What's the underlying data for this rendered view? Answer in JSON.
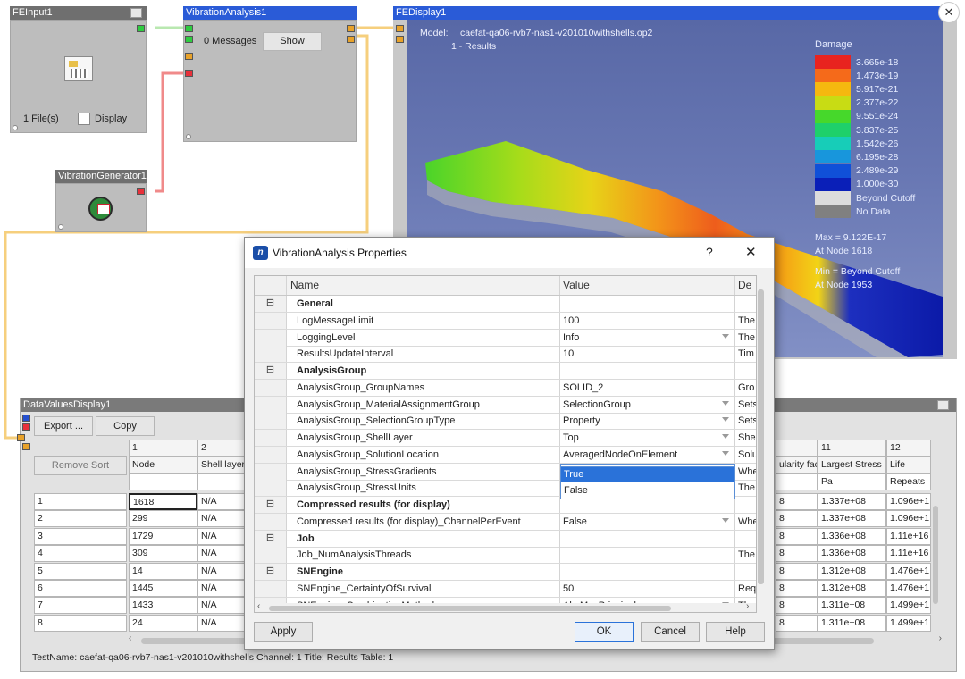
{
  "nodes": {
    "feinput": {
      "title": "FEInput1",
      "files_label": "1 File(s)",
      "display_label": "Display"
    },
    "vibration_analysis": {
      "title": "VibrationAnalysis1",
      "messages": "0 Messages",
      "show_button": "Show"
    },
    "vibration_generator": {
      "title": "VibrationGenerator1"
    }
  },
  "fedisplay": {
    "title": "FEDisplay1",
    "model_label": "Model:",
    "model_value": "caefat-qa06-rvb7-nas1-v201010withshells.op2",
    "subtitle": "1 - Results",
    "legend_title": "Damage",
    "legend": [
      {
        "color": "#e8231f",
        "label": "3.665e-18"
      },
      {
        "color": "#f56a1a",
        "label": "1.473e-19"
      },
      {
        "color": "#f5b80f",
        "label": "5.917e-21"
      },
      {
        "color": "#c8dc14",
        "label": "2.377e-22"
      },
      {
        "color": "#46d82b",
        "label": "9.551e-24"
      },
      {
        "color": "#1ed06a",
        "label": "3.837e-25"
      },
      {
        "color": "#17cdb8",
        "label": "1.542e-26"
      },
      {
        "color": "#1896dc",
        "label": "6.195e-28"
      },
      {
        "color": "#1050d8",
        "label": "2.489e-29"
      },
      {
        "color": "#0a1fb8",
        "label": "1.000e-30"
      },
      {
        "color": "#dcdcdc",
        "label": "Beyond Cutoff"
      },
      {
        "color": "#808080",
        "label": "No Data"
      }
    ],
    "max_line1": "Max = 9.122E-17",
    "max_line2": "At Node 1618",
    "min_line1": "Min = Beyond Cutoff",
    "min_line2": "At Node 1953"
  },
  "datavalues": {
    "title": "DataValuesDisplay1",
    "export_button": "Export ...",
    "copy_button": "Copy",
    "remove_sort_button": "Remove Sort",
    "col_numbers": [
      "1",
      "2",
      "11",
      "12"
    ],
    "col_headers": [
      "Node",
      "Shell layer",
      "ularity fac",
      "Largest Stress",
      "Life"
    ],
    "units": [
      "Pa",
      "Repeats"
    ],
    "rows": [
      {
        "idx": "1",
        "node": "1618",
        "shell": "N/A",
        "frac": "8",
        "stress": "1.337e+08",
        "life": "1.096e+1"
      },
      {
        "idx": "2",
        "node": "299",
        "shell": "N/A",
        "frac": "8",
        "stress": "1.337e+08",
        "life": "1.096e+1"
      },
      {
        "idx": "3",
        "node": "1729",
        "shell": "N/A",
        "frac": "8",
        "stress": "1.336e+08",
        "life": "1.11e+16"
      },
      {
        "idx": "4",
        "node": "309",
        "shell": "N/A",
        "frac": "8",
        "stress": "1.336e+08",
        "life": "1.11e+16"
      },
      {
        "idx": "5",
        "node": "14",
        "shell": "N/A",
        "frac": "8",
        "stress": "1.312e+08",
        "life": "1.476e+1"
      },
      {
        "idx": "6",
        "node": "1445",
        "shell": "N/A",
        "frac": "8",
        "stress": "1.312e+08",
        "life": "1.476e+1"
      },
      {
        "idx": "7",
        "node": "1433",
        "shell": "N/A",
        "frac": "8",
        "stress": "1.311e+08",
        "life": "1.499e+1"
      },
      {
        "idx": "8",
        "node": "24",
        "shell": "N/A",
        "frac": "8",
        "stress": "1.311e+08",
        "life": "1.499e+1"
      }
    ],
    "status": "TestName: caefat-qa06-rvb7-nas1-v201010withshells  Channel: 1  Title: Results  Table: 1"
  },
  "dialog": {
    "title": "VibrationAnalysis Properties",
    "help": "?",
    "close": "✕",
    "headers": {
      "name": "Name",
      "value": "Value",
      "desc": "De"
    },
    "rows": [
      {
        "type": "group",
        "expander": "⊟",
        "name": "General",
        "value": "",
        "desc": ""
      },
      {
        "type": "prop",
        "name": "LogMessageLimit",
        "value": "100",
        "desc": "The",
        "dropdown": false
      },
      {
        "type": "prop",
        "name": "LoggingLevel",
        "value": "Info",
        "desc": "The",
        "dropdown": true
      },
      {
        "type": "prop",
        "name": "ResultsUpdateInterval",
        "value": "10",
        "desc": "Tim",
        "dropdown": false
      },
      {
        "type": "group",
        "expander": "⊟",
        "name": "AnalysisGroup",
        "value": "",
        "desc": ""
      },
      {
        "type": "prop",
        "name": "AnalysisGroup_GroupNames",
        "value": "SOLID_2",
        "desc": "Gro",
        "dropdown": false
      },
      {
        "type": "prop",
        "name": "AnalysisGroup_MaterialAssignmentGroup",
        "value": "SelectionGroup",
        "desc": "Sets",
        "dropdown": true
      },
      {
        "type": "prop",
        "name": "AnalysisGroup_SelectionGroupType",
        "value": "Property",
        "desc": "Sets",
        "dropdown": true
      },
      {
        "type": "prop",
        "name": "AnalysisGroup_ShellLayer",
        "value": "Top",
        "desc": "She",
        "dropdown": true
      },
      {
        "type": "prop",
        "name": "AnalysisGroup_SolutionLocation",
        "value": "AveragedNodeOnElement",
        "desc": "Solu",
        "dropdown": true
      },
      {
        "type": "prop",
        "name": "AnalysisGroup_StressGradients",
        "value": "True",
        "desc": "Whe",
        "dropdown": true,
        "active": true
      },
      {
        "type": "prop",
        "name": "AnalysisGroup_StressUnits",
        "value": "",
        "desc": "The",
        "dropdown": false
      },
      {
        "type": "group",
        "expander": "⊟",
        "name": "Compressed results (for display)",
        "value": "",
        "desc": ""
      },
      {
        "type": "prop",
        "name": "Compressed results (for display)_ChannelPerEvent",
        "value": "False",
        "desc": "Whe",
        "dropdown": true
      },
      {
        "type": "group",
        "expander": "⊟",
        "name": "Job",
        "value": "",
        "desc": ""
      },
      {
        "type": "prop",
        "name": "Job_NumAnalysisThreads",
        "value": "",
        "desc": "The",
        "dropdown": false
      },
      {
        "type": "group",
        "expander": "⊟",
        "name": "SNEngine",
        "value": "",
        "desc": ""
      },
      {
        "type": "prop",
        "name": "SNEngine_CertaintyOfSurvival",
        "value": "50",
        "desc": "Req",
        "dropdown": false
      },
      {
        "type": "prop",
        "name": "SNEngine_CombinationMethod",
        "value": "AbsMaxPrincipal",
        "desc": "The",
        "dropdown": true
      }
    ],
    "dropdown_options": [
      "True",
      "False"
    ],
    "buttons": {
      "apply": "Apply",
      "ok": "OK",
      "cancel": "Cancel",
      "help": "Help"
    }
  },
  "window_close": "✕"
}
